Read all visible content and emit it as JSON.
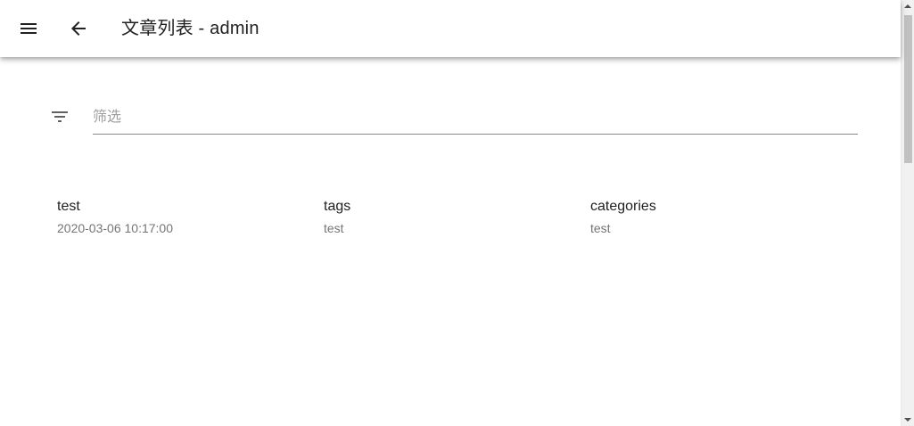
{
  "toolbar": {
    "title": "文章列表 - admin",
    "menu_icon": "menu-icon",
    "back_icon": "arrow-back-icon"
  },
  "filter": {
    "icon": "filter-list-icon",
    "placeholder": "筛选",
    "value": ""
  },
  "article": {
    "title": "test",
    "date": "2020-03-06 10:17:00",
    "tags_label": "tags",
    "tags_value": "test",
    "categories_label": "categories",
    "categories_value": "test"
  }
}
